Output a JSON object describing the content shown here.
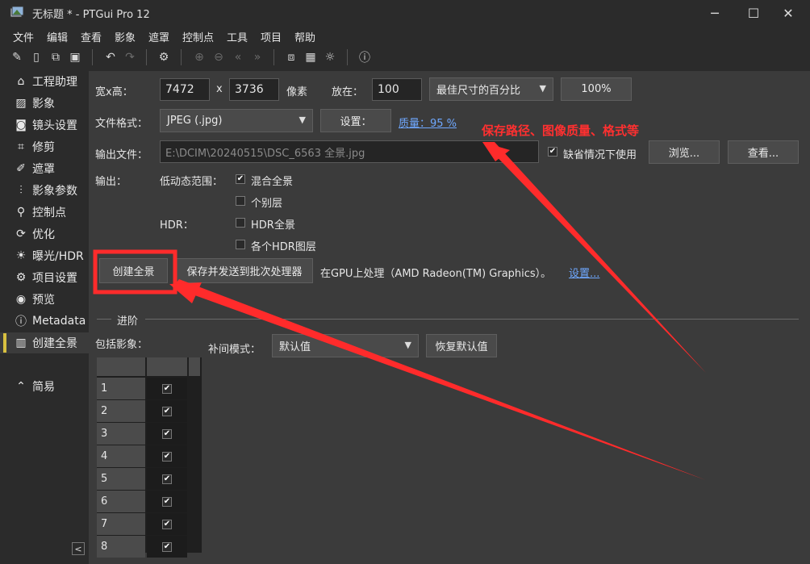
{
  "window": {
    "title": "无标题 * - PTGui Pro 12",
    "minimize": "─",
    "maximize": "☐",
    "close": "✕"
  },
  "menu": [
    "文件",
    "编辑",
    "查看",
    "影象",
    "遮罩",
    "控制点",
    "工具",
    "项目",
    "帮助"
  ],
  "sidebar": {
    "items": [
      {
        "label": "工程助理",
        "icon": "home-icon"
      },
      {
        "label": "影象",
        "icon": "image-icon"
      },
      {
        "label": "镜头设置",
        "icon": "camera-icon"
      },
      {
        "label": "修剪",
        "icon": "crop-icon"
      },
      {
        "label": "遮罩",
        "icon": "brush-icon"
      },
      {
        "label": "影象参数",
        "icon": "sliders-icon"
      },
      {
        "label": "控制点",
        "icon": "control-points-icon"
      },
      {
        "label": "优化",
        "icon": "optimize-icon"
      },
      {
        "label": "曝光/HDR",
        "icon": "sun-icon"
      },
      {
        "label": "项目设置",
        "icon": "gear-icon"
      },
      {
        "label": "预览",
        "icon": "eye-icon"
      },
      {
        "label": "Metadata",
        "icon": "info-icon"
      },
      {
        "label": "创建全景",
        "icon": "panorama-icon"
      }
    ],
    "simple": "简易",
    "active_index": 12
  },
  "size": {
    "label": "宽x高：",
    "width": "7472",
    "x": "x",
    "height": "3736",
    "unit": "像素",
    "scale_label": "放在：",
    "scale_value": "100",
    "scale_mode": "最佳尺寸的百分比",
    "percent_button": "100%"
  },
  "format": {
    "label": "文件格式：",
    "value": "JPEG (.jpg)",
    "settings_button": "设置：",
    "quality_link": "质量：95 %"
  },
  "output_file": {
    "label": "输出文件：",
    "path": "E:\\DCIM\\20240515\\DSC_6563 全景.jpg",
    "default_label": "缺省情况下使用",
    "default_checked": true,
    "browse_button": "浏览...",
    "view_button": "查看..."
  },
  "output": {
    "label": "输出：",
    "ldr_label": "低动态范围：",
    "hdr_label": "HDR：",
    "options": [
      {
        "label": "混合全景",
        "checked": true
      },
      {
        "label": "个别层",
        "checked": false
      },
      {
        "label": "HDR全景",
        "checked": false
      },
      {
        "label": "各个HDR图层",
        "checked": false
      }
    ]
  },
  "actions": {
    "create_button": "创建全景",
    "batch_button": "保存并发送到批次处理器",
    "gpu_text": "在GPU上处理（AMD Radeon(TM) Graphics）。",
    "gpu_settings_link": "设置..."
  },
  "advanced": {
    "title": "进阶",
    "include_label": "包括影象：",
    "interp_label": "补间模式：",
    "interp_value": "默认值",
    "reset_button": "恢复默认值"
  },
  "image_rows": [
    "1",
    "2",
    "3",
    "4",
    "5",
    "6",
    "7",
    "8"
  ],
  "annotation": {
    "text": "保存路径、图像质量、格式等",
    "color": "#ff3030"
  }
}
